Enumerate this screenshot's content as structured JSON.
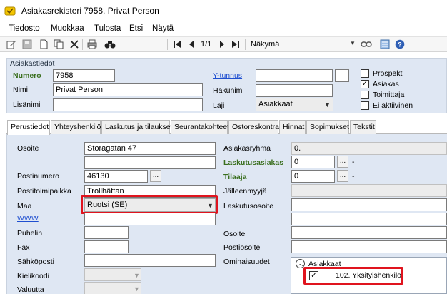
{
  "window": {
    "title": "Asiakasrekisteri 7958, Privat Person"
  },
  "menu": [
    "Tiedosto",
    "Muokkaa",
    "Tulosta",
    "Etsi",
    "Näytä"
  ],
  "toolbar": {
    "pager": "1/1",
    "view_label": "Näkymä"
  },
  "customer": {
    "section_title": "Asiakastiedot",
    "number_label": "Numero",
    "number_value": "7958",
    "name_label": "Nimi",
    "name_value": "Privat Person",
    "extra_name_label": "Lisänimi",
    "extra_name_value": "",
    "ytunnus_label": "Y-tunnus",
    "search_name_label": "Hakunimi",
    "type_label": "Laji",
    "type_value": "Asiakkaat",
    "checkboxes": [
      {
        "label": "Prospekti",
        "checked": false
      },
      {
        "label": "Asiakas",
        "checked": true
      },
      {
        "label": "Toimittaja",
        "checked": false
      },
      {
        "label": "Ei aktiivinen",
        "checked": false
      }
    ]
  },
  "tabs": [
    "Perustiedot",
    "Yhteyshenkilöt",
    "Laskutus ja tilaukset",
    "Seurantakohteet",
    "Ostoreskontra",
    "Hinnat",
    "Sopimukset",
    "Tekstit"
  ],
  "basic": {
    "address_label": "Osoite",
    "address_value": "Storagatan 47",
    "postcode_label": "Postinumero",
    "postcode_value": "46130",
    "city_label": "Postitoimipaikka",
    "city_value": "Trollhättan",
    "country_label": "Maa",
    "country_value": "Ruotsi (SE)",
    "www_label": "WWW",
    "phone_label": "Puhelin",
    "fax_label": "Fax",
    "email_label": "Sähköposti",
    "language_label": "Kielikoodi",
    "currency_label": "Valuutta"
  },
  "right": {
    "customer_group_label": "Asiakasryhmä",
    "customer_group_value": "0.",
    "billing_customer_label": "Laskutusasiakas",
    "billing_customer_value": "0",
    "orderer_label": "Tilaaja",
    "orderer_value": "0",
    "dash": "-",
    "reseller_label": "Jälleenmyyjä",
    "billing_address_label": "Laskutusosoite",
    "address2_label": "Osoite",
    "postal_address_label": "Postiosoite",
    "properties_label": "Ominaisuudet",
    "customers_group_title": "Asiakkaat",
    "customer_type_item": "102. Yksityishenkilö"
  }
}
